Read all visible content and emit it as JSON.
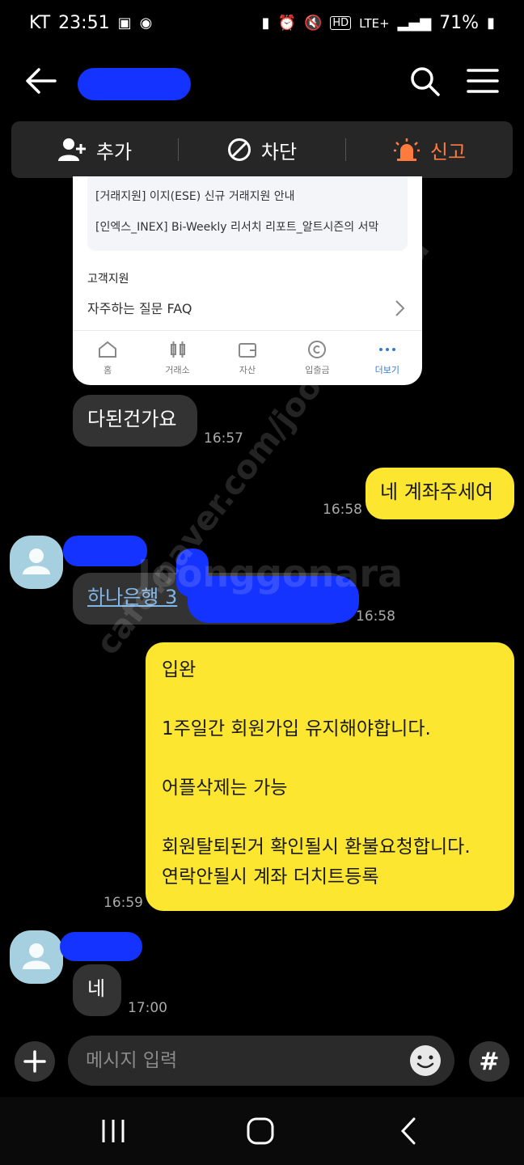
{
  "status_bar": {
    "carrier": "KT",
    "time": "23:51",
    "network": "LTE+",
    "battery": "71%"
  },
  "top_nav": {
    "contact_name": ""
  },
  "action_bar": {
    "add_label": "추가",
    "block_label": "차단",
    "report_label": "신고"
  },
  "screenshot_card": {
    "notices": [
      "[거래지원] 이지(ESE) 신규 거래지원 안내",
      "[인엑스_INEX] Bi-Weekly 리서치 리포트_알트시즌의 서막"
    ],
    "section_title": "고객지원",
    "faq_label": "자주하는 질문 FAQ",
    "nav": [
      "홈",
      "거래소",
      "자산",
      "입출금",
      "더보기"
    ]
  },
  "messages": [
    {
      "text": "다된건가요",
      "time": "16:57"
    },
    {
      "text": "네 계좌주세여",
      "time": "16:58"
    },
    {
      "text": "하나은행 3",
      "time": "16:58"
    },
    {
      "lines": [
        "입완",
        "",
        "1주일간 회원가입 유지해야합니다.",
        "",
        "어플삭제는 가능",
        "",
        "회원탈퇴된거 확인될시 환불요청합니다.",
        "연락안될시 계좌 더치트등록"
      ],
      "time": "16:59"
    },
    {
      "text": "네",
      "time": "17:00"
    }
  ],
  "input": {
    "placeholder": "메시지 입력"
  },
  "hash_label": "#",
  "watermark": {
    "logo": "Joonggonara",
    "url": "cafe.naver.com/joonggonara"
  },
  "colors": {
    "incoming_bubble": "#333333",
    "outgoing_bubble": "#fde62f",
    "report": "#ff7a3d",
    "avatar": "#a6cfe0",
    "active_tab": "#2f7bd9"
  }
}
